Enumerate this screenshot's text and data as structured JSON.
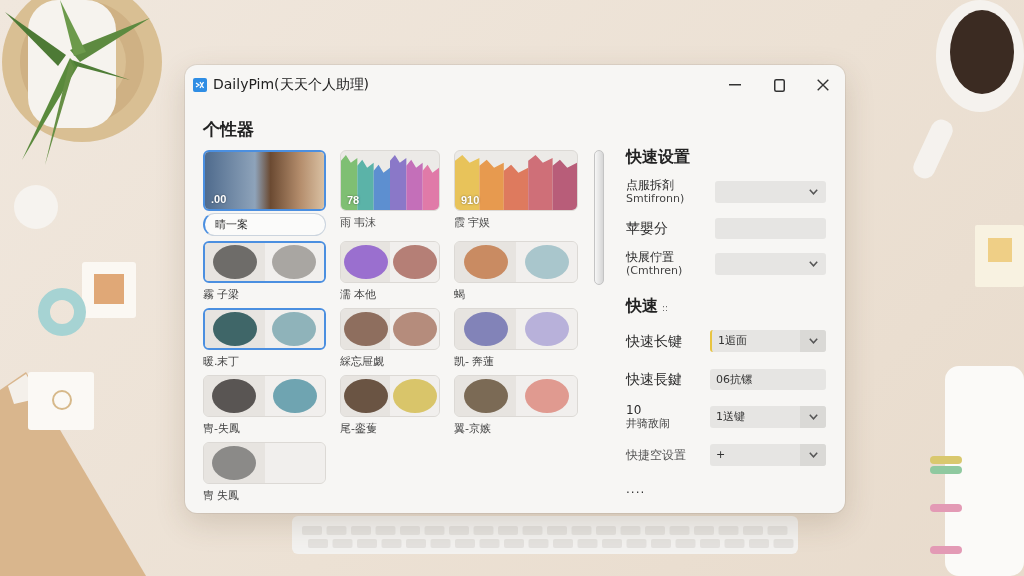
{
  "window": {
    "title": "DailyPim(天天个人助理)"
  },
  "themes": {
    "heading": "个性器",
    "items": [
      {
        "kind": "photo",
        "badge": ".00",
        "label": "晴一案",
        "selected": true,
        "active": true
      },
      {
        "kind": "stripes",
        "badge": "78",
        "label": "雨 韦沫",
        "swatches": [
          {
            "color": "#7fbf73"
          },
          {
            "color": "#5bb3a8"
          },
          {
            "color": "#5d8fd0"
          },
          {
            "color": "#8a78c8"
          },
          {
            "color": "#c46fb9"
          },
          {
            "color": "#e07aa8"
          }
        ],
        "selected": false,
        "active": false
      },
      {
        "kind": "stripes",
        "badge": "910",
        "label": "霞 宇娱",
        "swatches": [
          {
            "color": "#e8c35a"
          },
          {
            "color": "#e79a4f"
          },
          {
            "color": "#de7a5e"
          },
          {
            "color": "#cf6f78"
          },
          {
            "color": "#b85d79"
          }
        ],
        "selected": false,
        "active": false
      },
      {
        "kind": "blobs",
        "label": "霧 子梁",
        "swatches": [
          {
            "color": "#6e6c69"
          },
          {
            "color": "#a9a6a2"
          }
        ],
        "selected": true,
        "active": false
      },
      {
        "kind": "blobs",
        "label": "濡 本他",
        "swatches": [
          {
            "color": "#9a6fcf"
          },
          {
            "color": "#b57f76"
          }
        ],
        "selected": false,
        "active": false
      },
      {
        "kind": "blobs",
        "label": "蝎",
        "swatches": [
          {
            "color": "#c98b62"
          },
          {
            "color": "#a9c6cc"
          }
        ],
        "selected": false,
        "active": false
      },
      {
        "kind": "blobs",
        "label": "暖.末丁",
        "swatches": [
          {
            "color": "#3f6668"
          },
          {
            "color": "#8fb3ba"
          }
        ],
        "selected": true,
        "active": false
      },
      {
        "kind": "blobs",
        "label": "綵忘屉觑",
        "swatches": [
          {
            "color": "#8e6e5e"
          },
          {
            "color": "#b58c7c"
          }
        ],
        "selected": false,
        "active": false
      },
      {
        "kind": "blobs",
        "label": "凯- 奔蓮",
        "swatches": [
          {
            "color": "#8283b8"
          },
          {
            "color": "#b8b1da"
          }
        ],
        "selected": false,
        "active": false
      },
      {
        "kind": "blobs",
        "label": "冑-失鳳",
        "swatches": [
          {
            "color": "#595553"
          },
          {
            "color": "#6fa4b1"
          }
        ],
        "selected": false,
        "active": false
      },
      {
        "kind": "blobs",
        "label": "尾-銮蒦",
        "swatches": [
          {
            "color": "#6a5443"
          },
          {
            "color": "#d9c56a"
          }
        ],
        "selected": false,
        "active": false
      },
      {
        "kind": "blobs",
        "label": "翼-京嫉",
        "swatches": [
          {
            "color": "#7b6a55"
          },
          {
            "color": "#e09a90"
          }
        ],
        "selected": false,
        "active": false
      },
      {
        "kind": "blobs",
        "label": "冑 失鳳",
        "swatches": [
          {
            "color": "#8b8a88"
          }
        ],
        "selected": false,
        "active": false
      }
    ]
  },
  "settings": [
    {
      "heading": "快速设置",
      "rows": [
        {
          "kind": "select",
          "label": "点服拆剤",
          "sublabel": "Smtifronn)",
          "focused": false
        },
        {
          "kind": "input",
          "label": "苹嬰分",
          "focused": false
        },
        {
          "kind": "select",
          "label": "快展佇置",
          "sublabel": "(Cmthren)",
          "focused": false
        }
      ]
    },
    {
      "heading": "快速",
      "heading_mark": "::",
      "rows": [
        {
          "kind": "select",
          "label": "快速长键",
          "value": "1逅面",
          "focused": true
        },
        {
          "kind": "input",
          "label": "快速長鍵",
          "value": "06抗镙",
          "focused": false
        },
        {
          "kind": "select",
          "label": "10",
          "sublabel": "井骑敌闹",
          "value": "1送键",
          "focused": false
        },
        {
          "kind": "add",
          "label": "快捷空设置",
          "value": "+",
          "focused": false
        }
      ],
      "more": "...."
    }
  ]
}
